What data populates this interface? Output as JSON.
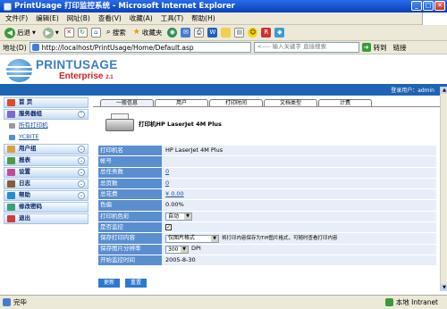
{
  "window": {
    "title": "PrintUsage 打印监控系统 - Microsoft Internet Explorer"
  },
  "menubar": {
    "items": [
      "文件(F)",
      "编辑(E)",
      "网址(B)",
      "查看(V)",
      "收藏(A)",
      "工具(T)",
      "帮助(H)"
    ]
  },
  "toolbar": {
    "back": "后退",
    "search": "搜索",
    "favorites": "收藏夹"
  },
  "address": {
    "label": "地址(D)",
    "url": "http://localhost/PrintUsage/Home/Default.asp",
    "search_placeholder": "<---- 输入关键字 直接搜索",
    "go": "转到",
    "links": "链接"
  },
  "brand": {
    "name": "PRINTUSAGE",
    "edition": "Enterprise",
    "version": "2.1"
  },
  "user_info": "登录用户：admin",
  "sidebar": {
    "home": "首 页",
    "server": "服务器组",
    "sub1": "所有打印机",
    "sub2": "YCBITE",
    "users": "用户组",
    "reports": "报表",
    "settings": "设置",
    "logs": "日志",
    "help": "帮助",
    "password": "修改密码",
    "exit": "退出"
  },
  "tabs": [
    "一般信息",
    "用户",
    "打印时间",
    "文档类型",
    "计费"
  ],
  "page": {
    "title": "打印机HP LaserJet 4M Plus"
  },
  "fields": {
    "name_label": "打印机名",
    "name_value": "HP LaserJet 4M Plus",
    "account_label": "帐号",
    "account_value": "",
    "pages_label": "总任务数",
    "pages_value": "0",
    "total_label": "总页数",
    "total_value": "0",
    "cost_label": "总花费",
    "cost_value": "¥ 0.00",
    "ratio_label": "色偏",
    "ratio_value": "0.00%",
    "color_label": "打印机色彩",
    "color_value": "自动",
    "monitor_label": "是否监控",
    "monitor_checked": "✓",
    "save_label": "保存打印内容",
    "save_value": "仅图片格式",
    "save_note": "将打印内容保存为Tiff图片格式，可随时查看打印内容",
    "dpi_label": "保存图片分辨率",
    "dpi_value": "300",
    "dpi_unit": "DPI",
    "start_label": "开始监控时间",
    "start_value": "2005-8-30"
  },
  "buttons": {
    "update": "更新",
    "reset": "重置"
  },
  "status": {
    "left": "完毕",
    "zone": "本地 Intranet"
  }
}
